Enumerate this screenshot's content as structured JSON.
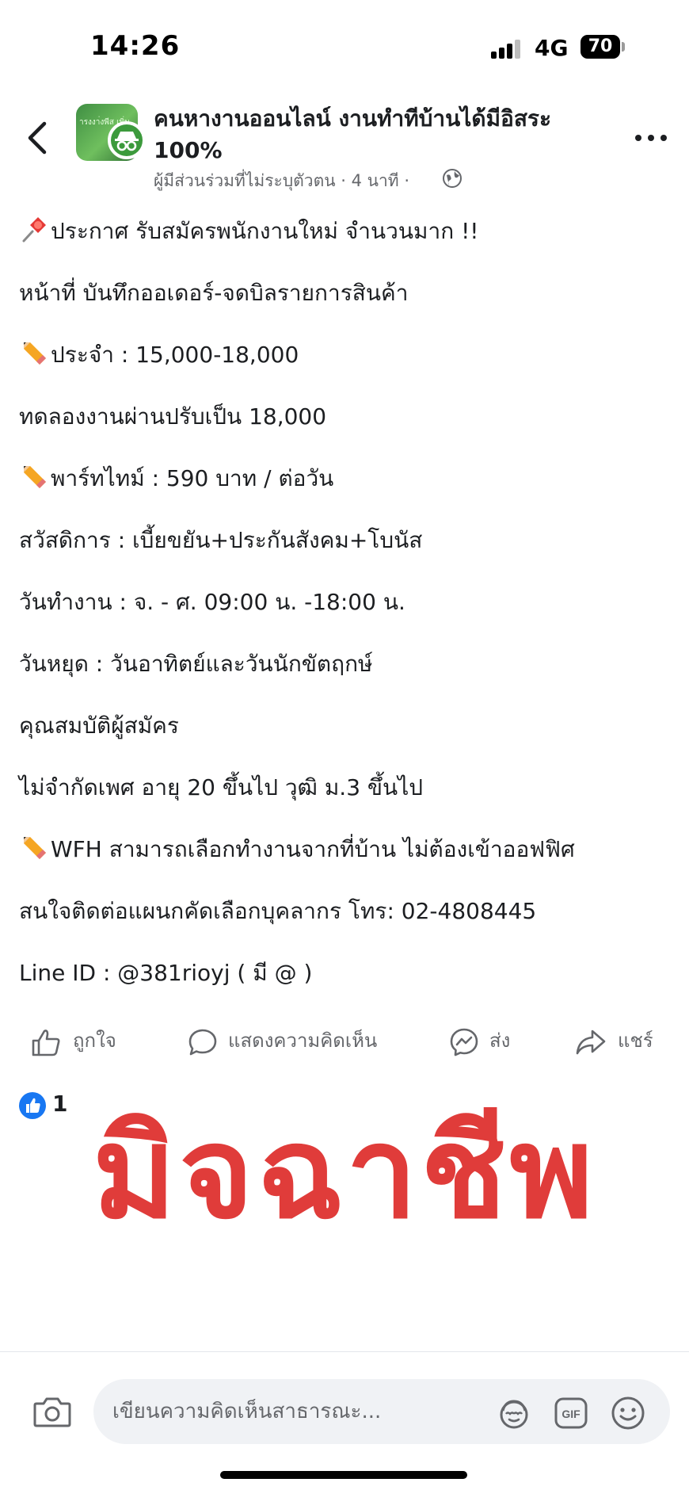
{
  "status_bar": {
    "time": "14:26",
    "network": "4G",
    "battery": "70"
  },
  "post": {
    "group_name": "คนหางานออนไลน์ งานทำทีบ้านได้มีอิสระ 100%",
    "avatar_text": "ารงงา่งพีส เพิ่ม",
    "meta": "ผู้มีส่วนร่วมที่ไม่ระบุตัวตน · 4 นาที ·",
    "lines": [
      "ประกาศ รับสมัครพนักงานใหม่ จำนวนมาก !!",
      "หน้าที่ บันทึกออเดอร์-จดบิลรายการสินค้า",
      "ประจำ : 15,000-18,000",
      " ทดลองงานผ่านปรับเป็น 18,000",
      "พาร์ทไทม์ : 590 บาท / ต่อวัน",
      "สวัสดิการ : เบี้ยขยัน+ประกันสังคม+โบนัส",
      "วันทำงาน : จ. - ศ. 09:00 น. -18:00 น.",
      "วันหยุด : วันอาทิตย์และวันนักขัตฤกษ์",
      "คุณสมบัติผู้สมัคร",
      "ไม่จำกัดเพศ อายุ 20 ขึ้นไป วุฒิ ม.3 ขึ้นไป",
      "WFH สามารถเลือกทำงานจากที่บ้าน ไม่ต้องเข้าออฟฟิศ",
      "สนใจติดต่อแผนกคัดเลือกบุคลากร โทร:  02-4808445",
      "Line ID :  @381rioyj   ( มี @ )"
    ]
  },
  "actions": {
    "like": "ถูกใจ",
    "comment": "แสดงความคิดเห็น",
    "send": "ส่ง",
    "share": "แชร์"
  },
  "reactions": {
    "count": "1"
  },
  "stamp": {
    "text": "มิจฉาชีพ",
    "color": "#e03c3a"
  },
  "composer": {
    "placeholder": "เขียนความคิดเห็นสาธารณะ...",
    "gif_label": "GIF"
  },
  "icons": {
    "line_0": "pushpin-icon",
    "line_2": "pencil-icon",
    "line_4": "pencil-icon",
    "line_10": "pencil-icon"
  },
  "colors": {
    "accent": "#1877f2",
    "text_secondary": "#65676b",
    "stamp": "#e03c3a"
  }
}
